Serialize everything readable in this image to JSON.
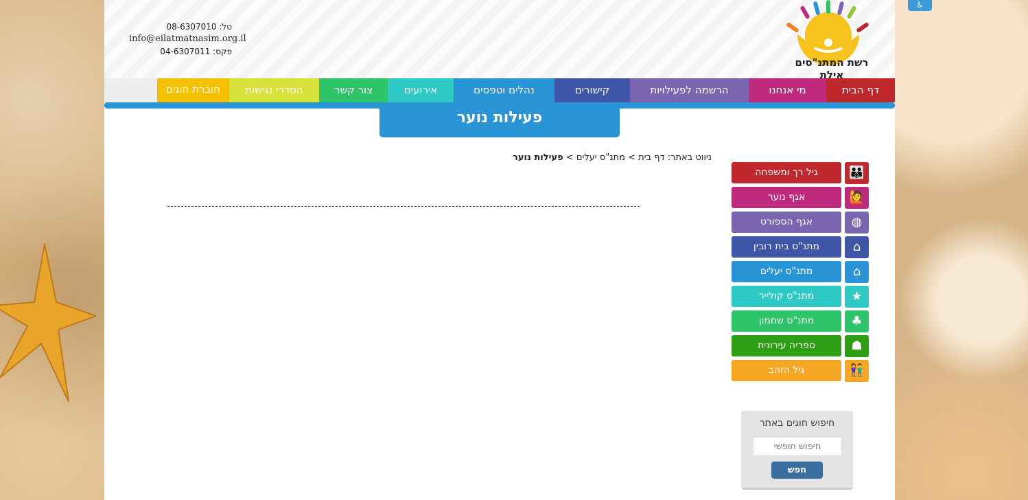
{
  "contact": {
    "phone": "טל: 08-6307010",
    "email": "info@eilatmatnasim.org.il",
    "fax": "פקס: 04-6307011"
  },
  "logo": {
    "text": "רשת המתנ\"סים אילת"
  },
  "nav": {
    "items": [
      {
        "label": "דף הבית",
        "color": "#c0282e"
      },
      {
        "label": "מי אנחנו",
        "color": "#bf2a7f"
      },
      {
        "label": "הרשמה לפעילויות",
        "color": "#7a66b0"
      },
      {
        "label": "קישורים",
        "color": "#3f55a8"
      },
      {
        "label": "נהלים וטפסים",
        "color": "#2a95d6"
      },
      {
        "label": "אירועים",
        "color": "#2ec9c4"
      },
      {
        "label": "צור קשר",
        "color": "#2ec46a"
      },
      {
        "label": "הסדרי נגישות",
        "color": "#d8e03a"
      },
      {
        "label": "חוברת חוגים",
        "color": "#f5c000"
      }
    ]
  },
  "page_title": "פעילות נוער",
  "breadcrumb": {
    "prefix": "ניווט באתר:",
    "home": "דף בית",
    "section": "מתנ\"ס יעלים",
    "current": "פעילות נוער",
    "separator": ">"
  },
  "sidebar": {
    "items": [
      {
        "label": "גיל רך ומשפחה",
        "color": "#c0282e",
        "icon": "family-icon"
      },
      {
        "label": "אגף נוער",
        "color": "#bf2a7f",
        "icon": "youth-icon"
      },
      {
        "label": "אגף הספורט",
        "color": "#7a66b0",
        "icon": "basketball-icon"
      },
      {
        "label": "מתנ\"ס בית רובין",
        "color": "#3f55a8",
        "icon": "house-heart-icon"
      },
      {
        "label": "מתנ\"ס יעלים",
        "color": "#2a95d6",
        "icon": "house-circle-icon"
      },
      {
        "label": "מתנ\"ס קולייר",
        "color": "#2ec9c4",
        "icon": "house-star-icon"
      },
      {
        "label": "מתנ\"ס שחמון",
        "color": "#2ec46a",
        "icon": "house-clover-icon"
      },
      {
        "label": "ספריה עירונית",
        "color": "#2e9e12",
        "icon": "reader-icon"
      },
      {
        "label": "גיל הזהב",
        "color": "#f5a623",
        "icon": "elderly-icon"
      }
    ]
  },
  "search": {
    "title": "חיפוש חוגים באתר",
    "placeholder": "חיפוש חופשי",
    "button": "חפש"
  }
}
